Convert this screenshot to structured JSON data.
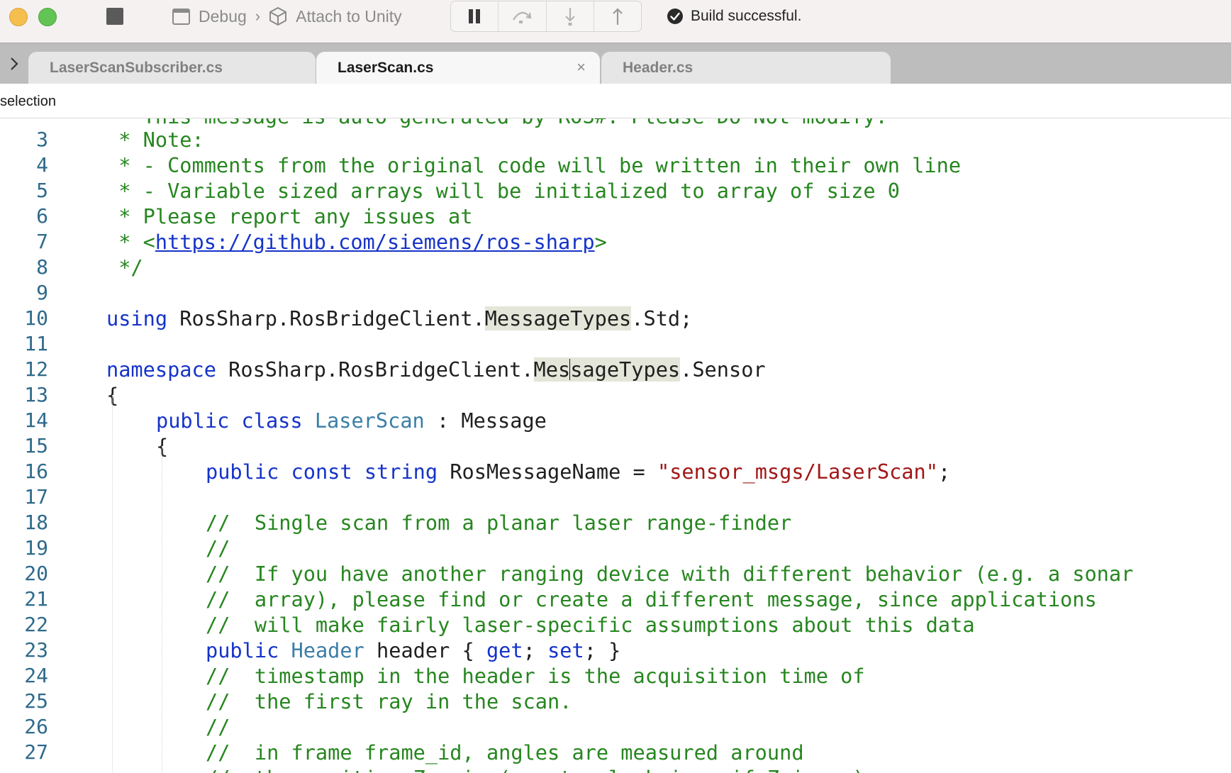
{
  "toolbar": {
    "scheme": {
      "name": "Debug",
      "separator": "›",
      "target": "Attach to Unity"
    },
    "status_text": "Build successful."
  },
  "tabs": [
    {
      "label": "LaserScanSubscriber.cs",
      "active": false
    },
    {
      "label": "LaserScan.cs",
      "active": true,
      "close": "×"
    },
    {
      "label": "Header.cs",
      "active": false
    }
  ],
  "breadcrumb": "selection",
  "editor": {
    "partial_top_line": " * This message is auto generated by ROS#. Please Do Not modify.",
    "lines": [
      {
        "n": "3",
        "indent": 0,
        "segments": [
          {
            "t": " * Note:",
            "c": "cmt"
          }
        ]
      },
      {
        "n": "4",
        "indent": 0,
        "segments": [
          {
            "t": " * - Comments from the original code will be written in their own line",
            "c": "cmt"
          }
        ]
      },
      {
        "n": "5",
        "indent": 0,
        "segments": [
          {
            "t": " * - Variable sized arrays will be initialized to array of size 0",
            "c": "cmt"
          }
        ]
      },
      {
        "n": "6",
        "indent": 0,
        "segments": [
          {
            "t": " * Please report any issues at",
            "c": "cmt"
          }
        ]
      },
      {
        "n": "7",
        "indent": 0,
        "segments": [
          {
            "t": " * <",
            "c": "cmt"
          },
          {
            "t": "https://github.com/siemens/ros-sharp",
            "c": "url"
          },
          {
            "t": ">",
            "c": "cmt"
          }
        ]
      },
      {
        "n": "8",
        "indent": 0,
        "segments": [
          {
            "t": " */",
            "c": "cmt"
          }
        ]
      },
      {
        "n": "9",
        "indent": 0,
        "segments": []
      },
      {
        "n": "10",
        "indent": 0,
        "segments": [
          {
            "t": "using",
            "c": "kw"
          },
          {
            "t": " RosSharp.RosBridgeClient.",
            "c": ""
          },
          {
            "t": "MessageTypes",
            "c": "hl"
          },
          {
            "t": ".Std;",
            "c": ""
          }
        ]
      },
      {
        "n": "11",
        "indent": 0,
        "segments": []
      },
      {
        "n": "12",
        "indent": 0,
        "segments": [
          {
            "t": "namespace",
            "c": "kw"
          },
          {
            "t": " RosSharp.RosBridgeClient.",
            "c": ""
          },
          {
            "t": "Mes",
            "c": "hl"
          },
          {
            "t": "",
            "c": "caret"
          },
          {
            "t": "sageTypes",
            "c": "hl"
          },
          {
            "t": ".Sensor",
            "c": ""
          }
        ]
      },
      {
        "n": "13",
        "indent": 0,
        "segments": [
          {
            "t": "{",
            "c": ""
          }
        ]
      },
      {
        "n": "14",
        "indent": 1,
        "segments": [
          {
            "t": "public",
            "c": "kw"
          },
          {
            "t": " ",
            "c": ""
          },
          {
            "t": "class",
            "c": "kw"
          },
          {
            "t": " ",
            "c": ""
          },
          {
            "t": "LaserScan",
            "c": "ty"
          },
          {
            "t": " : Message",
            "c": ""
          }
        ]
      },
      {
        "n": "15",
        "indent": 1,
        "segments": [
          {
            "t": "{",
            "c": ""
          }
        ]
      },
      {
        "n": "16",
        "indent": 2,
        "segments": [
          {
            "t": "public",
            "c": "kw"
          },
          {
            "t": " ",
            "c": ""
          },
          {
            "t": "const",
            "c": "kw"
          },
          {
            "t": " ",
            "c": ""
          },
          {
            "t": "string",
            "c": "kw"
          },
          {
            "t": " RosMessageName = ",
            "c": ""
          },
          {
            "t": "\"sensor_msgs/LaserScan\"",
            "c": "str"
          },
          {
            "t": ";",
            "c": ""
          }
        ]
      },
      {
        "n": "17",
        "indent": 2,
        "segments": []
      },
      {
        "n": "18",
        "indent": 2,
        "segments": [
          {
            "t": "//  Single scan from a planar laser range-finder",
            "c": "cmt"
          }
        ]
      },
      {
        "n": "19",
        "indent": 2,
        "segments": [
          {
            "t": "//",
            "c": "cmt"
          }
        ]
      },
      {
        "n": "20",
        "indent": 2,
        "segments": [
          {
            "t": "//  If you have another ranging device with different behavior (e.g. a sonar",
            "c": "cmt"
          }
        ]
      },
      {
        "n": "21",
        "indent": 2,
        "segments": [
          {
            "t": "//  array), please find or create a different message, since applications",
            "c": "cmt"
          }
        ]
      },
      {
        "n": "22",
        "indent": 2,
        "segments": [
          {
            "t": "//  will make fairly laser-specific assumptions about this data",
            "c": "cmt"
          }
        ]
      },
      {
        "n": "23",
        "indent": 2,
        "segments": [
          {
            "t": "public",
            "c": "kw"
          },
          {
            "t": " ",
            "c": ""
          },
          {
            "t": "Header",
            "c": "ty"
          },
          {
            "t": " header { ",
            "c": ""
          },
          {
            "t": "get",
            "c": "kw"
          },
          {
            "t": "; ",
            "c": ""
          },
          {
            "t": "set",
            "c": "kw"
          },
          {
            "t": "; }",
            "c": ""
          }
        ]
      },
      {
        "n": "24",
        "indent": 2,
        "segments": [
          {
            "t": "//  timestamp in the header is the acquisition time of",
            "c": "cmt"
          }
        ]
      },
      {
        "n": "25",
        "indent": 2,
        "segments": [
          {
            "t": "//  the first ray in the scan.",
            "c": "cmt"
          }
        ]
      },
      {
        "n": "26",
        "indent": 2,
        "segments": [
          {
            "t": "//",
            "c": "cmt"
          }
        ]
      },
      {
        "n": "27",
        "indent": 2,
        "segments": [
          {
            "t": "//  in frame frame_id, angles are measured around",
            "c": "cmt"
          }
        ]
      }
    ],
    "partial_bottom_line": "//  the positive Z axis (counterclockwise, if Z is up)"
  }
}
